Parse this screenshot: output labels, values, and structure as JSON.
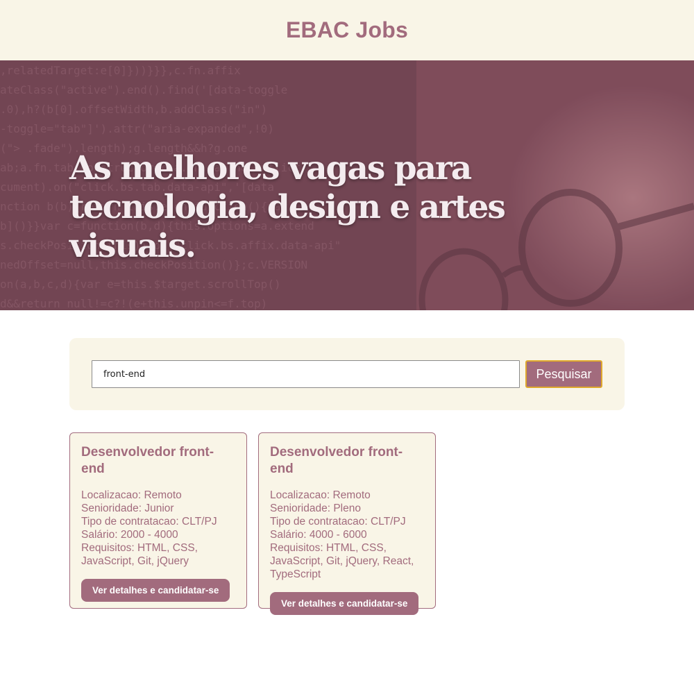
{
  "header": {
    "title": "EBAC Jobs"
  },
  "hero": {
    "headline": "As melhores vagas para tecnologia, design e artes visuais."
  },
  "search": {
    "value": "front-end",
    "button_label": "Pesquisar"
  },
  "jobs": [
    {
      "title": "Desenvolvedor front-end",
      "location": "Localizacao: Remoto",
      "seniority": "Senioridade: Junior",
      "contract": "Tipo de contratacao: CLT/PJ",
      "salary": "Salário: 2000 - 4000",
      "requirements": "Requisitos: HTML, CSS, JavaScript, Git, jQuery",
      "button_label": "Ver detalhes e candidatar-se"
    },
    {
      "title": "Desenvolvedor front-end",
      "location": "Localizacao: Remoto",
      "seniority": "Senioridade: Pleno",
      "contract": "Tipo de contratacao: CLT/PJ",
      "salary": "Salário: 4000 - 6000",
      "requirements": "Requisitos: HTML, CSS, JavaScript, Git, jQuery, React, TypeScript",
      "button_label": "Ver detalhes e candidatar-se"
    }
  ],
  "colors": {
    "brand": "#a26b7d",
    "background_cream": "#f9f5e7",
    "focus_border": "#e0a92c"
  }
}
